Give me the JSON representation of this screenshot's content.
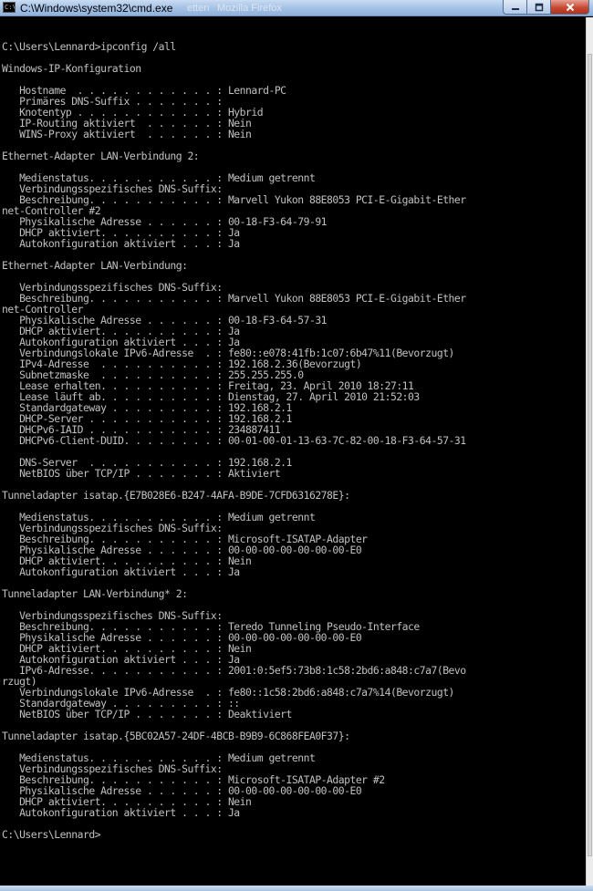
{
  "window": {
    "title": "C:\\Windows\\system32\\cmd.exe",
    "background_hint_1": "etten",
    "background_hint_2": "Mozilla Firefox",
    "icon_label": "C:\\",
    "controls": {
      "minimize": "minimize-icon",
      "maximize": "maximize-icon",
      "close": "close-icon"
    },
    "colors": {
      "console_bg": "#000000",
      "console_fg": "#c0c0c0",
      "titlebar": "#a9c4e6",
      "close_button": "#c74a33"
    }
  },
  "console": {
    "lines": [
      "",
      "C:\\Users\\Lennard>ipconfig /all",
      "",
      "Windows-IP-Konfiguration",
      "",
      "   Hostname  . . . . . . . . . . . . : Lennard-PC",
      "   Primäres DNS-Suffix . . . . . . . :",
      "   Knotentyp . . . . . . . . . . . . : Hybrid",
      "   IP-Routing aktiviert  . . . . . . : Nein",
      "   WINS-Proxy aktiviert  . . . . . . : Nein",
      "",
      "Ethernet-Adapter LAN-Verbindung 2:",
      "",
      "   Medienstatus. . . . . . . . . . . : Medium getrennt",
      "   Verbindungsspezifisches DNS-Suffix:",
      "   Beschreibung. . . . . . . . . . . : Marvell Yukon 88E8053 PCI-E-Gigabit-Ether",
      "net-Controller #2",
      "   Physikalische Adresse . . . . . . : 00-18-F3-64-79-91",
      "   DHCP aktiviert. . . . . . . . . . : Ja",
      "   Autokonfiguration aktiviert . . . : Ja",
      "",
      "Ethernet-Adapter LAN-Verbindung:",
      "",
      "   Verbindungsspezifisches DNS-Suffix:",
      "   Beschreibung. . . . . . . . . . . : Marvell Yukon 88E8053 PCI-E-Gigabit-Ether",
      "net-Controller",
      "   Physikalische Adresse . . . . . . : 00-18-F3-64-57-31",
      "   DHCP aktiviert. . . . . . . . . . : Ja",
      "   Autokonfiguration aktiviert . . . : Ja",
      "   Verbindungslokale IPv6-Adresse  . : fe80::e078:41fb:1c07:6b47%11(Bevorzugt)",
      "   IPv4-Adresse  . . . . . . . . . . : 192.168.2.36(Bevorzugt)",
      "   Subnetzmaske  . . . . . . . . . . : 255.255.255.0",
      "   Lease erhalten. . . . . . . . . . : Freitag, 23. April 2010 18:27:11",
      "   Lease läuft ab. . . . . . . . . . : Dienstag, 27. April 2010 21:52:03",
      "   Standardgateway . . . . . . . . . : 192.168.2.1",
      "   DHCP-Server . . . . . . . . . . . : 192.168.2.1",
      "   DHCPv6-IAID . . . . . . . . . . . : 234887411",
      "   DHCPv6-Client-DUID. . . . . . . . : 00-01-00-01-13-63-7C-82-00-18-F3-64-57-31",
      "",
      "   DNS-Server  . . . . . . . . . . . : 192.168.2.1",
      "   NetBIOS über TCP/IP . . . . . . . : Aktiviert",
      "",
      "Tunneladapter isatap.{E7B028E6-B247-4AFA-B9DE-7CFD6316278E}:",
      "",
      "   Medienstatus. . . . . . . . . . . : Medium getrennt",
      "   Verbindungsspezifisches DNS-Suffix:",
      "   Beschreibung. . . . . . . . . . . : Microsoft-ISATAP-Adapter",
      "   Physikalische Adresse . . . . . . : 00-00-00-00-00-00-00-E0",
      "   DHCP aktiviert. . . . . . . . . . : Nein",
      "   Autokonfiguration aktiviert . . . : Ja",
      "",
      "Tunneladapter LAN-Verbindung* 2:",
      "",
      "   Verbindungsspezifisches DNS-Suffix:",
      "   Beschreibung. . . . . . . . . . . : Teredo Tunneling Pseudo-Interface",
      "   Physikalische Adresse . . . . . . : 00-00-00-00-00-00-00-E0",
      "   DHCP aktiviert. . . . . . . . . . : Nein",
      "   Autokonfiguration aktiviert . . . : Ja",
      "   IPv6-Adresse. . . . . . . . . . . : 2001:0:5ef5:73b8:1c58:2bd6:a848:c7a7(Bevo",
      "rzugt)",
      "   Verbindungslokale IPv6-Adresse  . : fe80::1c58:2bd6:a848:c7a7%14(Bevorzugt)",
      "   Standardgateway . . . . . . . . . : ::",
      "   NetBIOS über TCP/IP . . . . . . . : Deaktiviert",
      "",
      "Tunneladapter isatap.{5BC02A57-24DF-4BCB-B9B9-6C868FEA0F37}:",
      "",
      "   Medienstatus. . . . . . . . . . . : Medium getrennt",
      "   Verbindungsspezifisches DNS-Suffix:",
      "   Beschreibung. . . . . . . . . . . : Microsoft-ISATAP-Adapter #2",
      "   Physikalische Adresse . . . . . . : 00-00-00-00-00-00-00-E0",
      "   DHCP aktiviert. . . . . . . . . . : Nein",
      "   Autokonfiguration aktiviert . . . : Ja",
      "",
      "C:\\Users\\Lennard>"
    ]
  }
}
